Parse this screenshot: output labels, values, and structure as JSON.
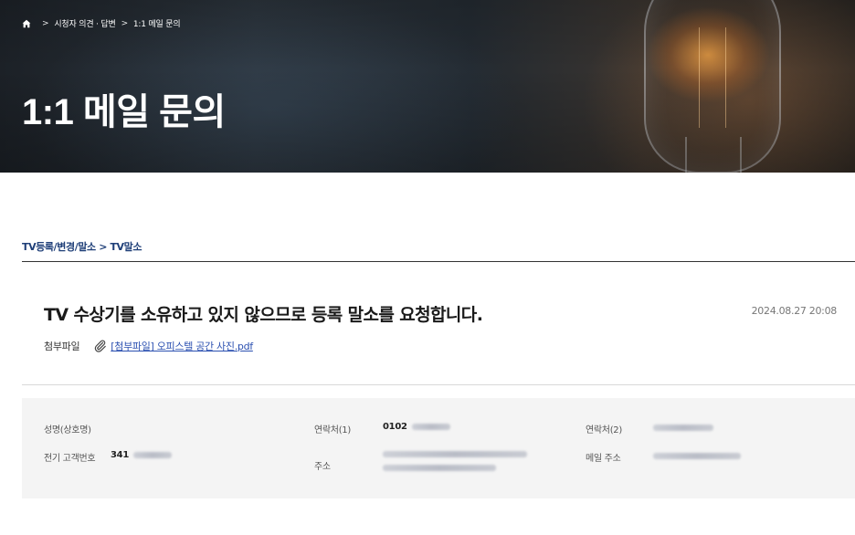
{
  "breadcrumb": {
    "home_icon": "home-icon",
    "items": [
      "시청자 의견 · 답변",
      "1:1 메일 문의"
    ],
    "separator": ">"
  },
  "hero": {
    "title": "1:1 메일 문의"
  },
  "category": "TV등록/변경/말소 > TV말소",
  "post": {
    "title": "TV 수상기를 소유하고 있지 않으므로 등록 말소를 요청합니다.",
    "date": "2024.08.27 20:08",
    "attachment_label": "첨부파일",
    "attachment_icon": "paperclip-icon",
    "attachment_name": "[첨부파일] 오피스텔 공간 사진.pdf"
  },
  "info": {
    "name_label": "성명(상호명)",
    "customer_no_label": "전기 고객번호",
    "customer_no_visible": "341",
    "phone1_label": "연락처(1)",
    "phone1_visible": "0102",
    "address_label": "주소",
    "phone2_label": "연락처(2)",
    "email_label": "메일 주소"
  },
  "colors": {
    "category_text": "#1f3f78",
    "link": "#2a4fb0",
    "info_bg": "#f4f4f4"
  }
}
